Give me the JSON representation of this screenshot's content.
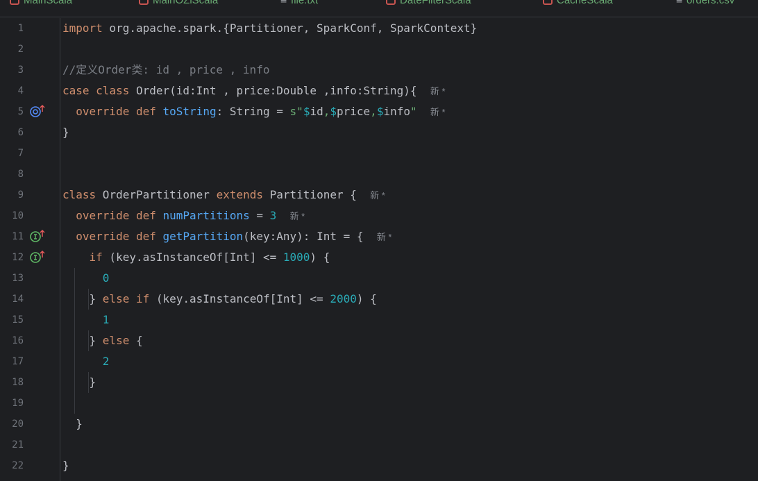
{
  "tabs": [
    {
      "label": "MainScala",
      "icon": "scala-file-icon"
    },
    {
      "label": "MainOZiScala",
      "icon": "scala-file-icon"
    },
    {
      "label": "file.txt",
      "icon": "text-file-icon"
    },
    {
      "label": "DateFilterScala",
      "icon": "scala-file-icon"
    },
    {
      "label": "CacheScala",
      "icon": "scala-file-icon"
    },
    {
      "label": "orders.csv",
      "icon": "text-file-icon"
    }
  ],
  "line_numbers": [
    "1",
    "2",
    "3",
    "4",
    "5",
    "6",
    "7",
    "8",
    "9",
    "10",
    "11",
    "12",
    "13",
    "14",
    "15",
    "16",
    "17",
    "18",
    "19",
    "20",
    "21",
    "22"
  ],
  "gutter_icons": {
    "line5": "override-target-icon",
    "line10": "implements-up-icon",
    "line11": "implements-up-icon"
  },
  "code": {
    "l1": {
      "kw": "import",
      "rest": " org.apache.spark.{Partitioner, SparkConf, SparkContext}"
    },
    "l3": {
      "comment": "//定义Order类: id , price , info"
    },
    "l4": {
      "kw1": "case",
      "kw2": "class",
      "rest": " Order(id:Int , price:Double ,info:String){",
      "hint": "新 *"
    },
    "l5": {
      "kw1": "override",
      "kw2": "def",
      "fn": "toString",
      "rest": ": String = ",
      "s_prefix": "s\"",
      "v1": "$",
      "id": "id",
      "sep1": ",",
      "v2": "$",
      "price": "price",
      "sep2": ",",
      "v3": "$",
      "info": "info",
      "s_end": "\"",
      "hint": "新 *"
    },
    "l6": {
      "text": "}"
    },
    "l9": {
      "kw1": "class",
      "name": " OrderPartitioner ",
      "kw2": "extends",
      "rest": " Partitioner {",
      "hint": "新 *"
    },
    "l10": {
      "kw1": "override",
      "kw2": "def",
      "fn": "numPartitions",
      "eq": " = ",
      "num": "3",
      "hint": "新 *"
    },
    "l11": {
      "kw1": "override",
      "kw2": "def",
      "fn": "getPartition",
      "rest": "(key:Any): Int = {",
      "hint": "新 *"
    },
    "l12": {
      "kw": "if",
      "a": " (key.asInstanceOf[Int] <= ",
      "num": "1000",
      "b": ") {"
    },
    "l13": {
      "num": "0"
    },
    "l14": {
      "a": "} ",
      "kw1": "else",
      "kw2": "if",
      "b": " (key.asInstanceOf[Int] <= ",
      "num": "2000",
      "c": ") {"
    },
    "l15": {
      "num": "1"
    },
    "l16": {
      "a": "} ",
      "kw": "else",
      "b": " {"
    },
    "l17": {
      "num": "2"
    },
    "l18": {
      "text": "}"
    },
    "l20": {
      "text": "}"
    },
    "l22": {
      "text": "}"
    }
  }
}
